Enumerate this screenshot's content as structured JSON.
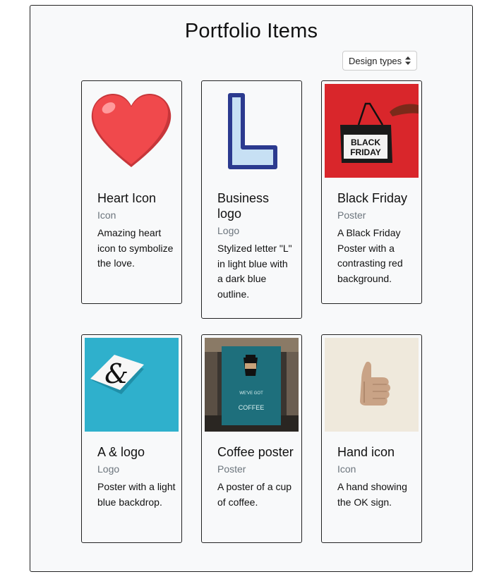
{
  "page": {
    "title": "Portfolio Items"
  },
  "filter": {
    "label": "Design types"
  },
  "items": [
    {
      "title": "Heart Icon",
      "category": "Icon",
      "description": "Amazing heart icon to symbolize the love.",
      "image": "heart-icon"
    },
    {
      "title": "Business logo",
      "category": "Logo",
      "description": "Stylized letter \"L\" in light blue with a dark blue outline.",
      "image": "letter-l-logo"
    },
    {
      "title": "Black Friday",
      "category": "Poster",
      "description": "A Black Friday Poster with a contrasting red background.",
      "image": "black-friday-bag",
      "image_text": [
        "BLACK",
        "FRIDAY"
      ]
    },
    {
      "title": "A & logo",
      "category": "Logo",
      "description": "Poster with a light blue backdrop.",
      "image": "ampersand-logo"
    },
    {
      "title": "Coffee poster",
      "category": "Poster",
      "description": "A poster of a cup of coffee.",
      "image": "coffee-poster",
      "image_text": [
        "WE'VE GOT",
        "COFFEE"
      ]
    },
    {
      "title": "Hand icon",
      "category": "Icon",
      "description": "A hand showing the OK sign.",
      "image": "thumbs-up-hand"
    }
  ],
  "colors": {
    "heart": "#f0494c",
    "logo_outline": "#2b3a8f",
    "logo_fill": "#c7e0f4",
    "friday_bg": "#d9262b",
    "ampersand_bg": "#2fb0cc",
    "hand_bg": "#efe9dc",
    "muted_text": "#6c757d"
  }
}
